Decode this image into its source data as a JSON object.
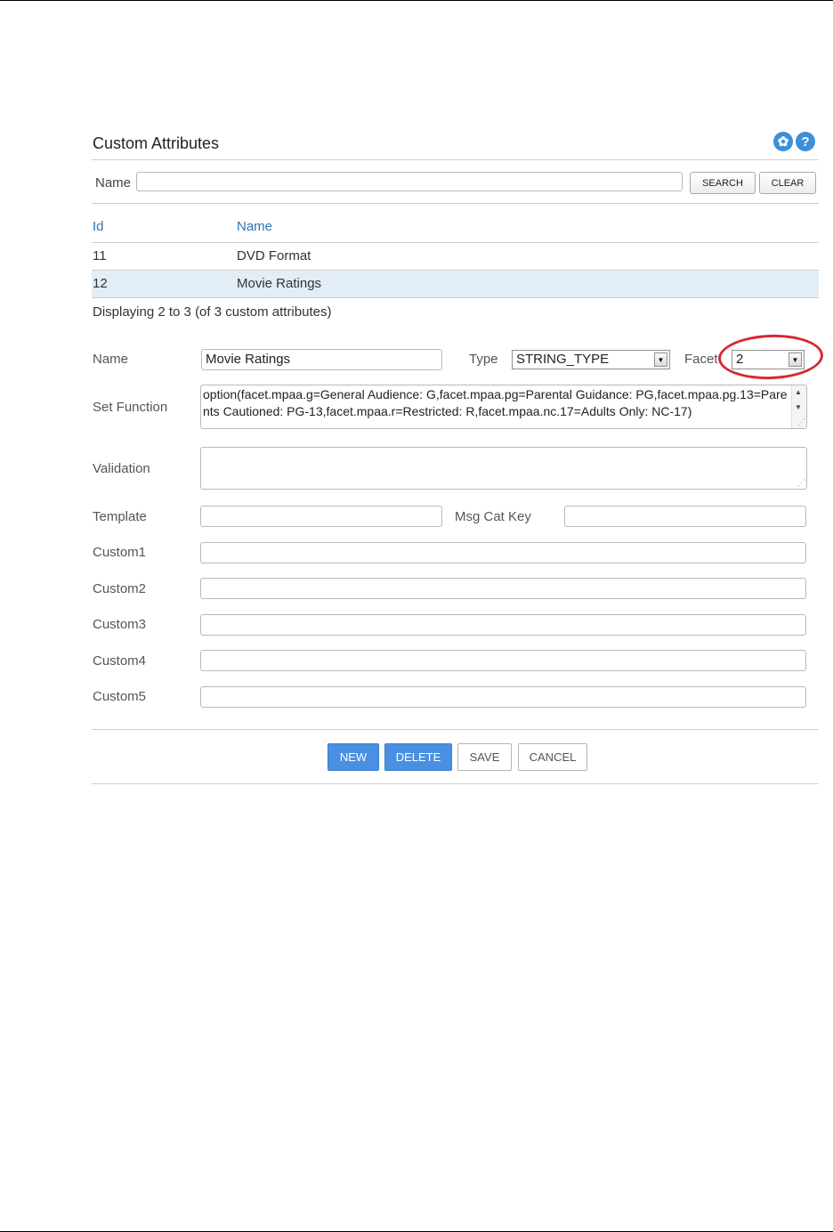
{
  "header": {
    "title": "Custom Attributes",
    "icons": [
      "gear-icon",
      "help-icon"
    ],
    "gear_glyph": "✿",
    "help_glyph": "?"
  },
  "search": {
    "label": "Name",
    "value": "",
    "search_label": "SEARCH",
    "clear_label": "CLEAR"
  },
  "grid": {
    "columns": [
      "Id",
      "Name"
    ],
    "rows": [
      {
        "id": "11",
        "name": "DVD Format",
        "selected": false
      },
      {
        "id": "12",
        "name": "Movie Ratings",
        "selected": true
      }
    ],
    "status": "Displaying 2 to 3 (of 3 custom attributes)"
  },
  "form": {
    "name_label": "Name",
    "name_value": "Movie Ratings",
    "type_label": "Type",
    "type_value": "STRING_TYPE",
    "facet_label": "Facet",
    "facet_value": "2",
    "set_function_label": "Set Function",
    "set_function_value": "option(facet.mpaa.g=General Audience: G,facet.mpaa.pg=Parental Guidance: PG,facet.mpaa.pg.13=Parents Cautioned: PG-13,facet.mpaa.r=Restricted: R,facet.mpaa.nc.17=Adults Only: NC-17)",
    "validation_label": "Validation",
    "validation_value": "",
    "template_label": "Template",
    "template_value": "",
    "msg_cat_key_label": "Msg Cat Key",
    "msg_cat_key_value": "",
    "custom1_label": "Custom1",
    "custom2_label": "Custom2",
    "custom3_label": "Custom3",
    "custom4_label": "Custom4",
    "custom5_label": "Custom5"
  },
  "actions": {
    "new_label": "NEW",
    "delete_label": "DELETE",
    "save_label": "SAVE",
    "cancel_label": "CANCEL"
  },
  "colors": {
    "accent": "#4a90e2",
    "link": "#2b74b4",
    "selected_row": "#e3edf6",
    "highlight_ellipse": "#d9282f"
  }
}
